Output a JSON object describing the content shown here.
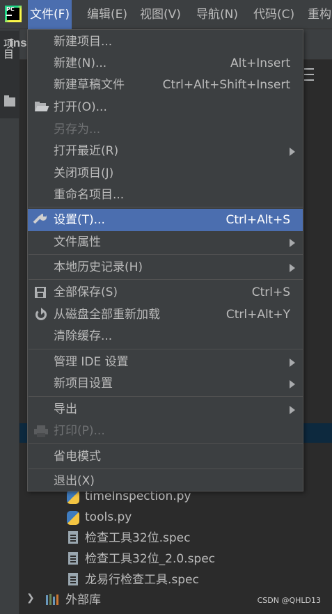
{
  "menubar": {
    "items": [
      {
        "label": "文件(F)",
        "active": true
      },
      {
        "label": "编辑(E)"
      },
      {
        "label": "视图(V)"
      },
      {
        "label": "导航(N)"
      },
      {
        "label": "代码(C)"
      },
      {
        "label": "重构"
      }
    ]
  },
  "left_strip": {
    "project_tab": "项目"
  },
  "tool_window": {
    "title": "Ins"
  },
  "file_menu": {
    "items": [
      {
        "label": "新建项目..."
      },
      {
        "label": "新建(N)...",
        "shortcut": "Alt+Insert"
      },
      {
        "label": "新建草稿文件",
        "shortcut": "Ctrl+Alt+Shift+Insert"
      },
      {
        "label": "打开(O)...",
        "icon": "folder-open-icon"
      },
      {
        "label": "另存为...",
        "disabled": true
      },
      {
        "label": "打开最近(R)",
        "submenu": true
      },
      {
        "label": "关闭项目(J)"
      },
      {
        "label": "重命名项目..."
      },
      {
        "label": "设置(T)...",
        "shortcut": "Ctrl+Alt+S",
        "icon": "wrench-icon",
        "selected": true
      },
      {
        "label": "文件属性",
        "submenu": true
      },
      {
        "label": "本地历史记录(H)",
        "submenu": true
      },
      {
        "label": "全部保存(S)",
        "shortcut": "Ctrl+S",
        "icon": "save-icon"
      },
      {
        "label": "从磁盘全部重新加载",
        "shortcut": "Ctrl+Alt+Y",
        "icon": "reload-icon"
      },
      {
        "label": "清除缓存..."
      },
      {
        "label": "管理 IDE 设置",
        "submenu": true
      },
      {
        "label": "新项目设置",
        "submenu": true
      },
      {
        "label": "导出",
        "submenu": true
      },
      {
        "label": "打印(P)...",
        "disabled": true,
        "icon": "printer-icon"
      },
      {
        "label": "省电模式"
      },
      {
        "label": "退出(X)"
      }
    ]
  },
  "project_tree": {
    "items": [
      {
        "label": "timeInspection.py",
        "icon": "python-file-icon"
      },
      {
        "label": "tools.py",
        "icon": "python-file-icon"
      },
      {
        "label": "检查工具32位.spec",
        "icon": "text-file-icon"
      },
      {
        "label": "检查工具32位_2.0.spec",
        "icon": "text-file-icon"
      },
      {
        "label": "龙易行检查工具.spec",
        "icon": "text-file-icon"
      }
    ],
    "external_libraries": "外部库"
  },
  "watermark": "CSDN @QHLD13",
  "colors": {
    "menu_bg": "#3c3f41",
    "selection": "#4b6eaf",
    "editor_bg": "#2b2b2b",
    "text": "#bbbbbb"
  }
}
